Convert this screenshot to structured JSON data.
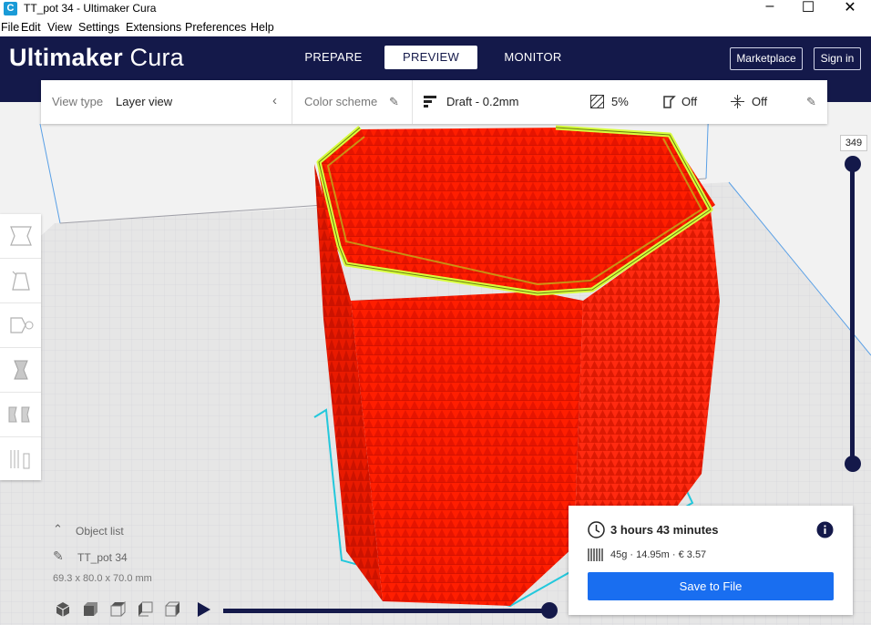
{
  "window": {
    "title": "TT_pot 34 - Ultimaker Cura",
    "app_icon": "C"
  },
  "menu": [
    "File",
    "Edit",
    "View",
    "Settings",
    "Extensions",
    "Preferences",
    "Help"
  ],
  "header": {
    "logo_bold": "Ultimaker",
    "logo_light": " Cura",
    "tabs": [
      {
        "label": "PREPARE",
        "active": false
      },
      {
        "label": "PREVIEW",
        "active": true
      },
      {
        "label": "MONITOR",
        "active": false
      }
    ],
    "marketplace": "Marketplace",
    "sign_in": "Sign in"
  },
  "toolbar": {
    "view_type_label": "View type",
    "view_type_value": "Layer view",
    "color_scheme_label": "Color scheme",
    "profile": "Draft - 0.2mm",
    "infill": "5%",
    "support": "Off",
    "adhesion": "Off"
  },
  "layer_slider": {
    "current_layer": "349"
  },
  "object": {
    "list_label": "Object list",
    "name": "TT_pot 34",
    "dimensions": "69.3 x 80.0 x 70.0 mm"
  },
  "print": {
    "time": "3 hours 43 minutes",
    "material": "45g · 14.95m · € 3.57",
    "save_label": "Save to File"
  },
  "colors": {
    "header_bg": "#14194a",
    "accent_blue": "#196ef0",
    "model_red": "#ff1a00",
    "wall_yellow": "#d8ff3c"
  }
}
